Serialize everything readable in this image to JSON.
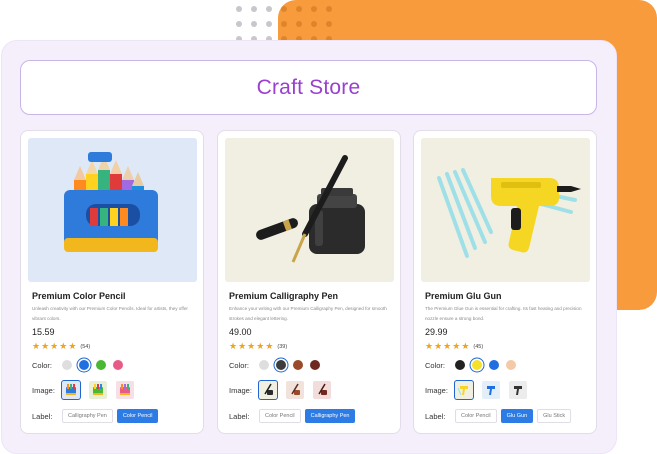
{
  "store": {
    "title": "Craft Store"
  },
  "labels": {
    "color": "Color:",
    "image": "Image:",
    "label": "Label:"
  },
  "products": [
    {
      "name": "Premium Color Pencil",
      "description": "Unleash creativity with our Premium Color Pencils. Ideal for artists, they offer vibrant colors.",
      "price": "15.59",
      "rating": 5,
      "reviews": "(54)",
      "colors": [
        "#dedede",
        "#1f6fe0",
        "#4ab832",
        "#e85b86"
      ],
      "selected_color": 1,
      "image_icons": [
        "pencil-box-icon",
        "pencil-box-icon",
        "pencil-box-icon"
      ],
      "chips": [
        "Calligraphy Pen",
        "Color Pencil"
      ],
      "selected_chip": 1
    },
    {
      "name": "Premium Calligraphy Pen",
      "description": "Enhance your writing with our Premium Calligraphy Pen, designed for smooth strokes and elegant lettering.",
      "price": "49.00",
      "rating": 5,
      "reviews": "(39)",
      "colors": [
        "#dedede",
        "#3c3c3c",
        "#9a4a2a",
        "#6e2a1e"
      ],
      "selected_color": 1,
      "image_icons": [
        "ink-pen-icon",
        "ink-pen-icon",
        "ink-pen-icon"
      ],
      "chips": [
        "Color Pencil",
        "Calligraphy Pen"
      ],
      "selected_chip": 1
    },
    {
      "name": "Premium Glu Gun",
      "description": "The Premium Glue Gun is essential for crafting. Its fast heating and precision nozzle ensure a strong bond.",
      "price": "29.99",
      "rating": 5,
      "reviews": "(45)",
      "colors": [
        "#222222",
        "#f5e02a",
        "#1f6fe0",
        "#f4c9a8"
      ],
      "selected_color": 1,
      "image_icons": [
        "glue-gun-icon",
        "glue-gun-icon",
        "glue-gun-icon"
      ],
      "chips": [
        "Color Pencil",
        "Glu Gun",
        "Glu Stick"
      ],
      "selected_chip": 1
    }
  ],
  "colors": {
    "accent": "#9a3fd0",
    "orange": "#f89b3c",
    "select_blue": "#2d7be4",
    "star": "#f0a21b"
  }
}
